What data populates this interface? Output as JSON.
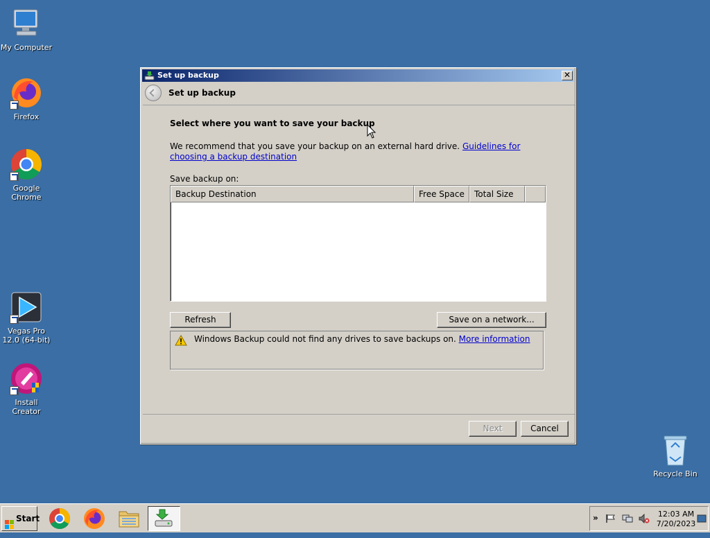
{
  "desktop": {
    "icons": [
      {
        "label": "My Computer",
        "icon": "computer-icon"
      },
      {
        "label": "Firefox",
        "icon": "firefox-icon"
      },
      {
        "label": "Google Chrome",
        "icon": "chrome-icon"
      },
      {
        "label": "Vegas Pro 12.0 (64-bit)",
        "icon": "vegas-icon"
      },
      {
        "label": "Install Creator",
        "icon": "install-creator-icon"
      },
      {
        "label": "Recycle Bin",
        "icon": "recycle-bin-icon"
      }
    ]
  },
  "window": {
    "title": "Set up backup",
    "header_title": "Set up backup",
    "heading": "Select where you want to save your backup",
    "recommend_text": "We recommend that you save your backup on an external hard drive.",
    "guidelines_link": "Guidelines for choosing a backup destination",
    "save_on_label": "Save backup on:",
    "columns": [
      "Backup Destination",
      "Free Space",
      "Total Size",
      ""
    ],
    "rows": [],
    "refresh_label": "Refresh",
    "save_network_label": "Save on a network...",
    "warning_text": "Windows Backup could not find any drives to save backups on.",
    "more_info_link": "More information",
    "next_label": "Next",
    "cancel_label": "Cancel",
    "close_glyph": "✕"
  },
  "taskbar": {
    "start_label": "Start",
    "pinned": [
      "chrome-icon",
      "firefox-icon",
      "file-explorer-icon",
      "backup-icon"
    ],
    "tray_chevron": "»",
    "time": "12:03 AM",
    "date": "7/20/2023"
  },
  "colors": {
    "desktop": "#3a6ea5",
    "window_face": "#d4d0c8",
    "title_start": "#0a246a",
    "title_end": "#a6caf0",
    "link": "#0000cc"
  }
}
